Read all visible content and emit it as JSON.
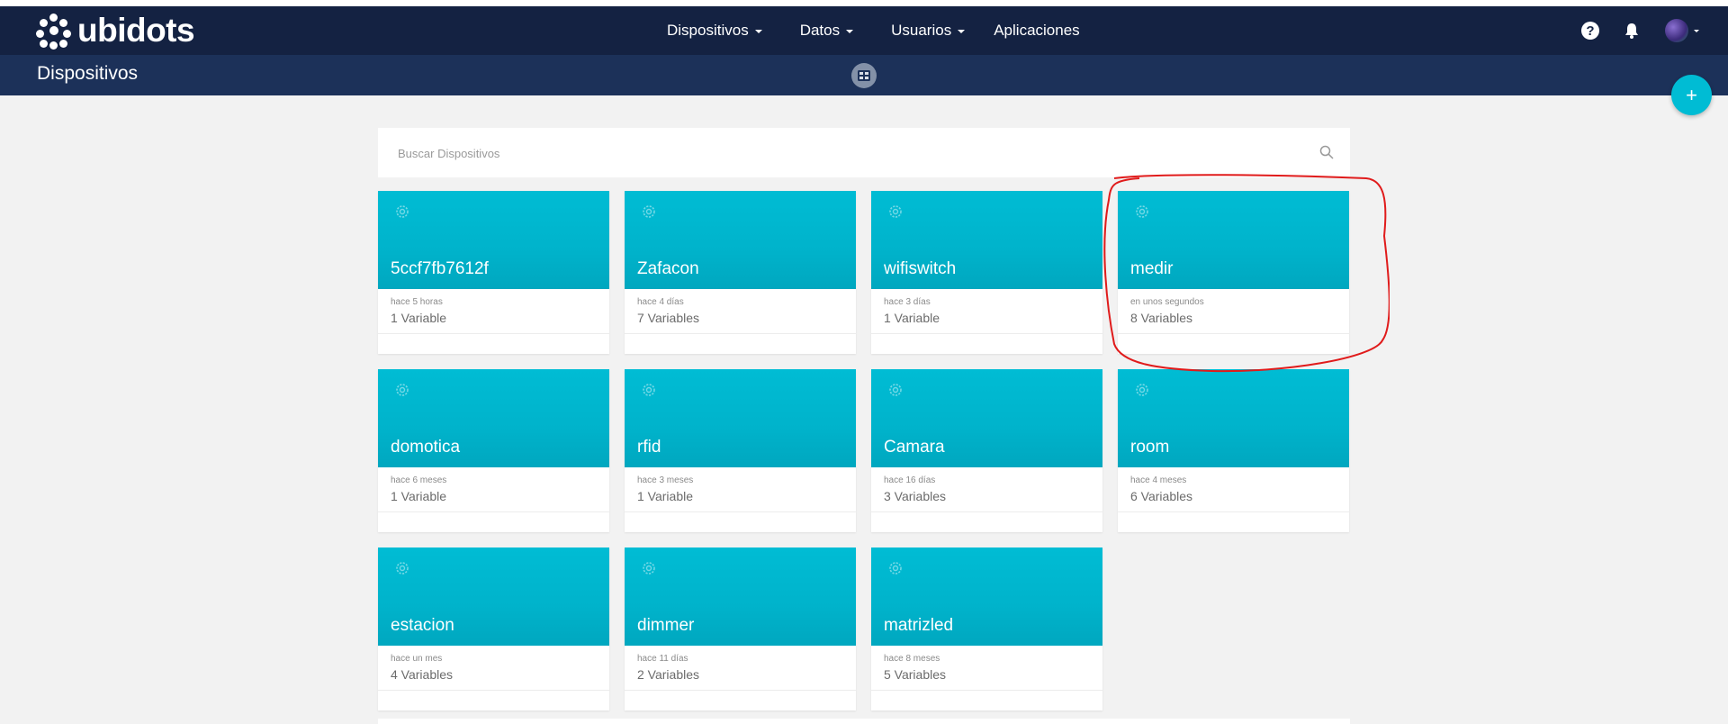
{
  "brand": {
    "logo_text": "ubidots"
  },
  "nav": {
    "items": [
      {
        "label": "Dispositivos",
        "has_caret": true
      },
      {
        "label": "Datos",
        "has_caret": true
      },
      {
        "label": "Usuarios",
        "has_caret": true
      },
      {
        "label": "Aplicaciones",
        "has_caret": false
      }
    ],
    "help_label": "?"
  },
  "page": {
    "title": "Dispositivos",
    "add_label": "+"
  },
  "search": {
    "placeholder": "Buscar Dispositivos",
    "value": ""
  },
  "devices": [
    {
      "name": "5ccf7fb7612f",
      "last_activity": "hace 5 horas",
      "variables": "1 Variable"
    },
    {
      "name": "Zafacon",
      "last_activity": "hace 4 días",
      "variables": "7 Variables"
    },
    {
      "name": "wifiswitch",
      "last_activity": "hace 3 días",
      "variables": "1 Variable"
    },
    {
      "name": "medir",
      "last_activity": "en unos segundos",
      "variables": "8 Variables"
    },
    {
      "name": "domotica",
      "last_activity": "hace 6 meses",
      "variables": "1 Variable"
    },
    {
      "name": "rfid",
      "last_activity": "hace 3 meses",
      "variables": "1 Variable"
    },
    {
      "name": "Camara",
      "last_activity": "hace 16 días",
      "variables": "3 Variables"
    },
    {
      "name": "room",
      "last_activity": "hace 4 meses",
      "variables": "6 Variables"
    },
    {
      "name": "estacion",
      "last_activity": "hace un mes",
      "variables": "4 Variables"
    },
    {
      "name": "dimmer",
      "last_activity": "hace 11 días",
      "variables": "2 Variables"
    },
    {
      "name": "matrizled",
      "last_activity": "hace 8 meses",
      "variables": "5 Variables"
    }
  ],
  "colors": {
    "navbar": "#142242",
    "subbar": "#1c3159",
    "card_accent": "#00bcd4",
    "annotation": "#e01b1b"
  },
  "icons": {
    "device": "gear-icon",
    "search": "search-icon",
    "help": "help-icon",
    "notifications": "bell-icon",
    "view": "grid-view-icon"
  }
}
